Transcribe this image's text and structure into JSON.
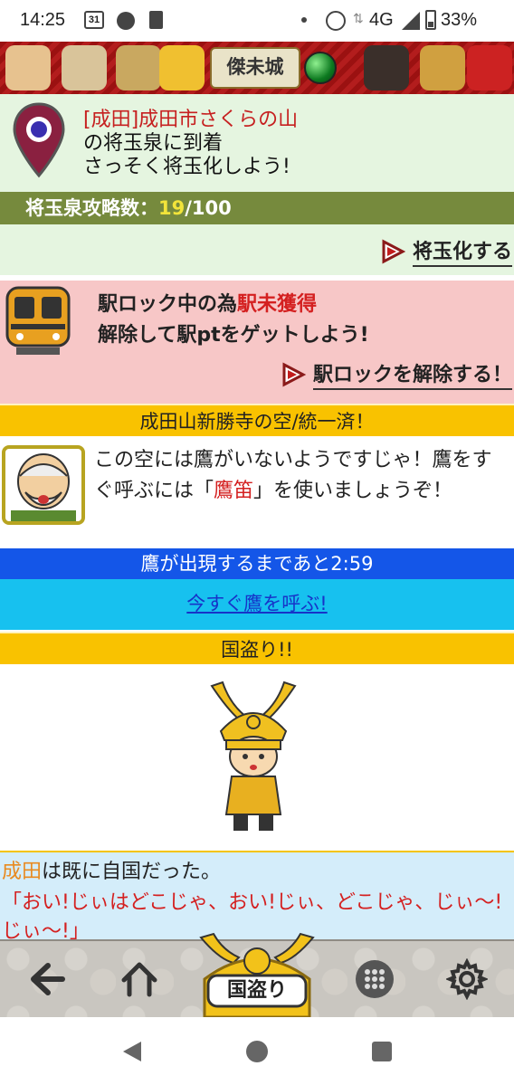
{
  "status_bar": {
    "time": "14:25",
    "calendar_day": "31",
    "network": "4G",
    "battery": "33%",
    "updown": "⇅"
  },
  "banner": {
    "logo_text": "傑未城"
  },
  "arrival": {
    "location": "[成田]成田市さくらの山",
    "line2": "の将玉泉に到着",
    "line3": "さっそく将玉化しよう!"
  },
  "progress": {
    "label": "将玉泉攻略数：",
    "current": "19",
    "total": "/100"
  },
  "gyoku_button": "将玉化する",
  "station_lock": {
    "line1_prefix": "駅ロック中の為",
    "line1_red": "駅未獲得",
    "line2": "解除して駅ptをゲットしよう!",
    "unlock_button": "駅ロックを解除する！"
  },
  "sky_header": "成田山新勝寺の空/統一済！",
  "elder_message": {
    "text_before": "この空には鷹がいないようですじゃ！鷹をすぐ呼ぶには「",
    "highlight": "鷹笛",
    "text_after": "」を使いましょうぞ！"
  },
  "hawk_timer": "鷹が出現するまであと2:59",
  "call_hawk_link": "今すぐ鷹を呼ぶ!",
  "kunitori_header": "国盗り!!",
  "result": {
    "place": "成田",
    "line1_rest": "は既に自国だった。",
    "line2": "「おい!じぃはどこじゃ、おい!じぃ、どこじゃ、じぃ〜!じぃ〜!」"
  },
  "game_nav": {
    "center_label": "国盗り",
    "icons": [
      "back-arrow-icon",
      "home-icon",
      "kunitori-icon",
      "menu-grid-icon",
      "settings-gear-icon"
    ]
  },
  "colors": {
    "green_bar": "#768a3d",
    "yellow_bar": "#f9c200",
    "blue_bar": "#1456e8",
    "cyan_bar": "#17c1ef",
    "pink_box": "#f7c7c7",
    "mint_box": "#e5f5e0",
    "result_box": "#d4edfa"
  }
}
